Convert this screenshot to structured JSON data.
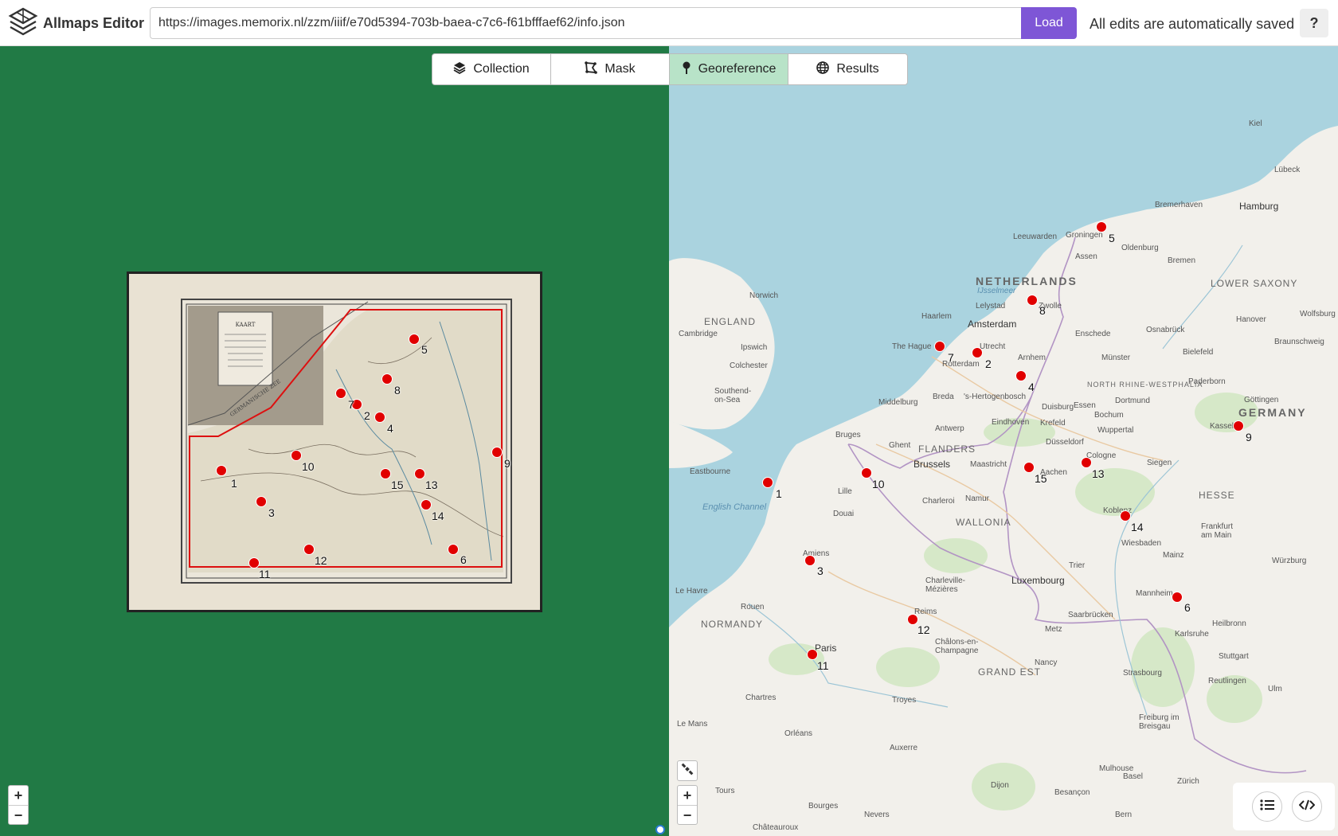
{
  "header": {
    "app_title": "Allmaps Editor",
    "url_value": "https://images.memorix.nl/zzm/iiif/e70d5394-703b-baea-c7c6-f61bfffaef62/info.json",
    "load_label": "Load",
    "save_status": "All edits are automatically saved",
    "help_label": "?"
  },
  "tabs": [
    {
      "label": "Collection",
      "icon": "layers-icon"
    },
    {
      "label": "Mask",
      "icon": "mask-icon"
    },
    {
      "label": "Georeference",
      "icon": "pin-icon",
      "active": true
    },
    {
      "label": "Results",
      "icon": "globe-icon"
    }
  ],
  "zoom": {
    "in": "+",
    "out": "−"
  },
  "image_map": {
    "cartouche_title": "KAART",
    "coast_label": "GERMANISCHE ZEE"
  },
  "gcp_labels": [
    "1",
    "2",
    "3",
    "4",
    "5",
    "6",
    "7",
    "8",
    "9",
    "10",
    "11",
    "12",
    "13",
    "14",
    "15"
  ],
  "basemap": {
    "countries": {
      "netherlands": "NETHERLANDS",
      "germany": "GERMANY"
    },
    "regions": {
      "england": "ENGLAND",
      "lower_saxony": "LOWER SAXONY",
      "flanders": "FLANDERS",
      "wallonia": "WALLONIA",
      "normandy": "NORMANDY",
      "grand_est": "GRAND EST",
      "hesse": "HESSE",
      "nrw": "NORTH RHINE-WESTPHALIA"
    },
    "water": {
      "english_channel": "English Channel",
      "ijsselmeer": "IJsselmeer"
    },
    "cities": {
      "hamburg": "Hamburg",
      "bremen": "Bremen",
      "groningen": "Groningen",
      "leeuwarden": "Leeuwarden",
      "oldenburg": "Oldenburg",
      "assen": "Assen",
      "norwich": "Norwich",
      "cambridge": "Cambridge",
      "ipswich": "Ipswich",
      "colchester": "Colchester",
      "southend": "Southend-on-Sea",
      "amsterdam": "Amsterdam",
      "haarlem": "Haarlem",
      "the_hague": "The Hague",
      "rotterdam": "Rotterdam",
      "utrecht": "Utrecht",
      "lelystad": "Lelystad",
      "zwolle": "Zwolle",
      "arnhem": "Arnhem",
      "enschede": "Enschede",
      "osnabruck": "Osnabrück",
      "hannover": "Hanover",
      "munster": "Münster",
      "bielefeld": "Bielefeld",
      "dortmund": "Dortmund",
      "essen": "Essen",
      "duisburg": "Duisburg",
      "dusseldorf": "Düsseldorf",
      "wuppertal": "Wuppertal",
      "cologne": "Cologne",
      "kassel": "Kassel",
      "gottingen": "Göttingen",
      "middelburg": "Middelburg",
      "breda": "Breda",
      "s_hertogenbosch": "'s-Hertogenbosch",
      "eindhoven": "Eindhoven",
      "antwerp": "Antwerp",
      "bruges": "Bruges",
      "ghent": "Ghent",
      "brussels": "Brussels",
      "maastricht": "Maastricht",
      "aachen": "Aachen",
      "lille": "Lille",
      "charleroi": "Charleroi",
      "namur": "Namur",
      "douai": "Douai",
      "eastbourne": "Eastbourne",
      "koblenz": "Koblenz",
      "siegen": "Siegen",
      "frankfurt": "Frankfurt am Main",
      "wiesbaden": "Wiesbaden",
      "mainz": "Mainz",
      "wurzburg": "Würzburg",
      "mannheim": "Mannheim",
      "heilbronn": "Heilbronn",
      "karlsruhe": "Karlsruhe",
      "stuttgart": "Stuttgart",
      "luxembourg": "Luxembourg",
      "trier": "Trier",
      "saarbrucken": "Saarbrücken",
      "metz": "Metz",
      "nancy": "Nancy",
      "strasbourg": "Strasbourg",
      "charleville": "Charleville-Mézières",
      "amiens": "Amiens",
      "rouen": "Rouen",
      "le_havre": "Le Havre",
      "paris": "Paris",
      "reims": "Reims",
      "chalons": "Châlons-en-Champagne",
      "troyes": "Troyes",
      "chartres": "Chartres",
      "orleans": "Orléans",
      "le_mans": "Le Mans",
      "tours": "Tours",
      "auxerre": "Auxerre",
      "dijon": "Dijon",
      "besancon": "Besançon",
      "basel": "Basel",
      "zurich": "Zürich",
      "freiburg": "Freiburg im Breisgau",
      "bern": "Bern",
      "kiel": "Kiel",
      "lubeck": "Lübeck",
      "bremerhaven": "Bremerhaven",
      "wolfsburg": "Wolfsburg",
      "braunschweig": "Braunschweig",
      "paderborn": "Paderborn",
      "krefeld": "Krefeld",
      "bochum": "Bochum",
      "mulhouse": "Mulhouse",
      "reutlingen": "Reutlingen",
      "ulm": "Ulm",
      "bourges": "Bourges",
      "nevers": "Nevers",
      "chateauroux": "Châteauroux"
    }
  }
}
